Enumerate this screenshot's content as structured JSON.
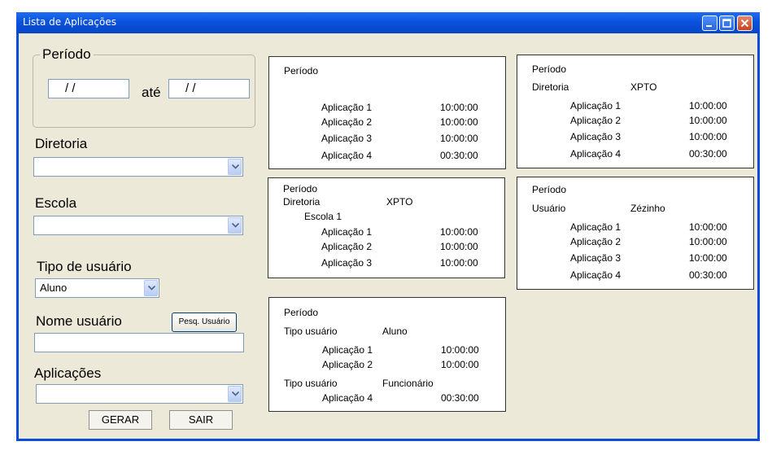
{
  "window": {
    "title": "Lista de Aplicações"
  },
  "form": {
    "periodo_label": "Período",
    "date_from": "/     /",
    "ate_label": "até",
    "date_to": "/     /",
    "diretoria_label": "Diretoria",
    "diretoria_value": "",
    "escola_label": "Escola",
    "escola_value": "",
    "tipo_label": "Tipo de usuário",
    "tipo_value": "Aluno",
    "nome_label": "Nome usuário",
    "pesq_button": "Pesq. Usuário",
    "nome_value": "",
    "aplicacoes_label": "Aplicações",
    "aplicacoes_value": "",
    "gerar_button": "GERAR",
    "sair_button": "SAIR"
  },
  "cards": {
    "c1": {
      "periodo": "Período",
      "rows": [
        [
          "Aplicação 1",
          "10:00:00"
        ],
        [
          "Aplicação 2",
          "10:00:00"
        ],
        [
          "Aplicação 3",
          "10:00:00"
        ],
        [
          "Aplicação 4",
          "00:30:00"
        ]
      ]
    },
    "c2": {
      "periodo": "Período",
      "dir_label": "Diretoria",
      "dir_value": "XPTO",
      "rows": [
        [
          "Aplicação 1",
          "10:00:00"
        ],
        [
          "Aplicação 2",
          "10:00:00"
        ],
        [
          "Aplicação 3",
          "10:00:00"
        ],
        [
          "Aplicação 4",
          "00:30:00"
        ]
      ]
    },
    "c3": {
      "periodo": "Período",
      "dir_label": "Diretoria",
      "dir_value": "XPTO",
      "escola": "Escola 1",
      "rows": [
        [
          "Aplicação 1",
          "10:00:00"
        ],
        [
          "Aplicação 2",
          "10:00:00"
        ],
        [
          "Aplicação 3",
          "10:00:00"
        ]
      ]
    },
    "c4": {
      "periodo": "Período",
      "user_label": "Usuário",
      "user_value": "Zézinho",
      "rows": [
        [
          "Aplicação 1",
          "10:00:00"
        ],
        [
          "Aplicação 2",
          "10:00:00"
        ],
        [
          "Aplicação 3",
          "10:00:00"
        ],
        [
          "Aplicação 4",
          "00:30:00"
        ]
      ]
    },
    "c5": {
      "periodo": "Período",
      "tipo1_label": "Tipo usuário",
      "tipo1_value": "Aluno",
      "rows1": [
        [
          "Aplicação 1",
          "10:00:00"
        ],
        [
          "Aplicação 2",
          "10:00:00"
        ]
      ],
      "tipo2_label": "Tipo usuário",
      "tipo2_value": "Funcionário",
      "rows2": [
        [
          "Aplicação 4",
          "00:30:00"
        ]
      ]
    }
  }
}
